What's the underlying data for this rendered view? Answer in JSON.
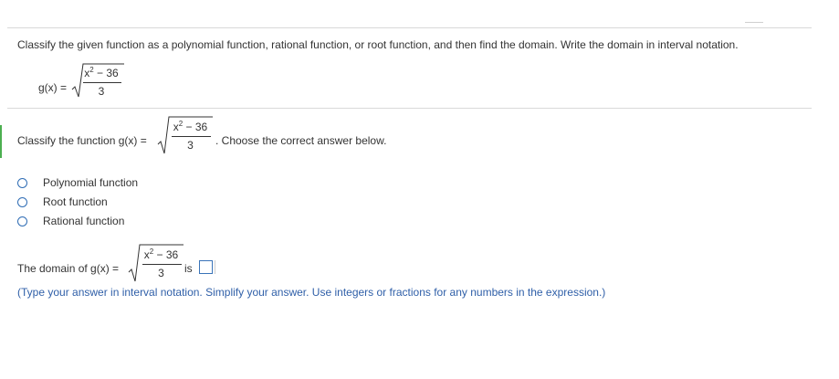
{
  "question": {
    "instruction": "Classify the given function as a polynomial function, rational function, or root function, and then find the domain.  Write the domain in interval notation.",
    "function_lhs": "g(x) =",
    "numerator_base": "x",
    "numerator_exp": "2",
    "numerator_rest": " − 36",
    "denominator": "3"
  },
  "part1": {
    "prompt_prefix": "Classify the function g(x) =",
    "prompt_suffix": ". Choose the correct answer below.",
    "options": [
      {
        "label": "Polynomial function"
      },
      {
        "label": "Root function"
      },
      {
        "label": "Rational function"
      }
    ]
  },
  "part2": {
    "prompt_prefix": "The domain of g(x) =",
    "prompt_suffix": "is",
    "hint": "(Type your answer in interval notation. Simplify your answer. Use integers or fractions for any numbers in the expression.)"
  },
  "colors": {
    "radio_border": "#2f6db5",
    "hint_text": "#2f5fa8",
    "active_marker": "#4caf50"
  }
}
